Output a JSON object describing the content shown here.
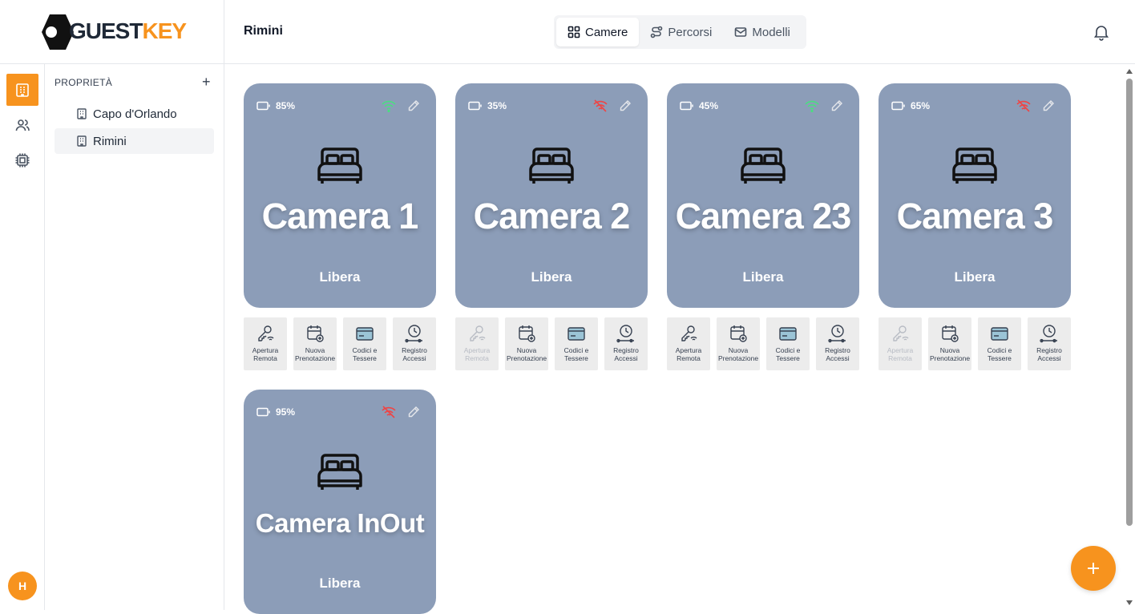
{
  "brand": {
    "logo_left": "GUEST",
    "logo_right": "KEY",
    "accent": "#f7931e"
  },
  "header": {
    "title": "Rimini",
    "tabs": [
      {
        "label": "Camere",
        "active": true,
        "icon": "grid-icon"
      },
      {
        "label": "Percorsi",
        "active": false,
        "icon": "route-icon"
      },
      {
        "label": "Modelli",
        "active": false,
        "icon": "mail-icon"
      }
    ],
    "notifications_icon": "bell-icon"
  },
  "rail": {
    "items": [
      {
        "icon": "building-icon",
        "active": true
      },
      {
        "icon": "users-icon",
        "active": false
      },
      {
        "icon": "chip-icon",
        "active": false
      }
    ],
    "avatar_initial": "H"
  },
  "sidebar": {
    "heading": "PROPRIETÀ",
    "add_label": "+",
    "items": [
      {
        "label": "Capo d'Orlando",
        "active": false
      },
      {
        "label": "Rimini",
        "active": true
      }
    ]
  },
  "rooms": [
    {
      "name": "Camera 1",
      "battery": "85%",
      "status": "Libera",
      "online": true
    },
    {
      "name": "Camera 2",
      "battery": "35%",
      "status": "Libera",
      "online": false
    },
    {
      "name": "Camera 23",
      "battery": "45%",
      "status": "Libera",
      "online": true
    },
    {
      "name": "Camera 3",
      "battery": "65%",
      "status": "Libera",
      "online": false
    },
    {
      "name": "Camera InOut",
      "battery": "95%",
      "status": "Libera",
      "online": false
    }
  ],
  "actions": {
    "remote": "Apertura Remota",
    "booking": "Nuova Prenotazione",
    "codes": "Codici e Tessere",
    "log": "Registro Accessi"
  },
  "fab_label": "+",
  "colors": {
    "card": "#8c9db8",
    "wifi_on": "#4ade80",
    "wifi_off": "#ef4444"
  }
}
